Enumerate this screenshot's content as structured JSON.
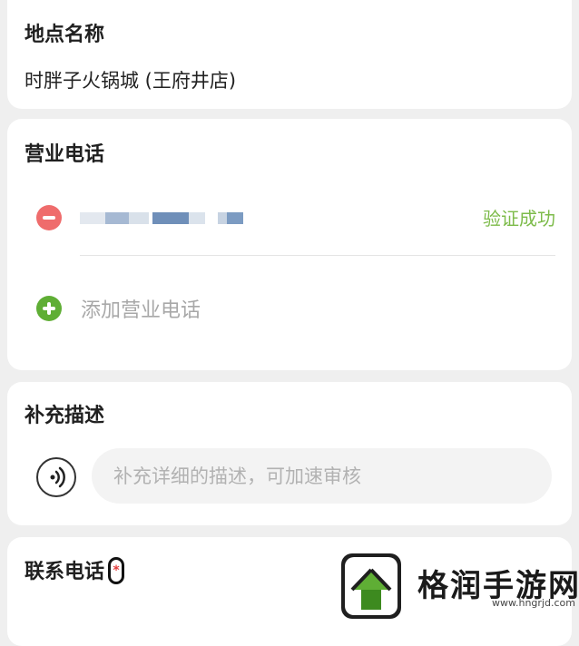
{
  "location": {
    "title": "地点名称",
    "value": "时胖子火锅城 (王府井店)"
  },
  "business_phone": {
    "title": "营业电话",
    "verify_status": "验证成功",
    "add_label": "添加营业电话",
    "colors": {
      "remove": "#ef6c6c",
      "add": "#5fae35",
      "verified": "#7dbb4a"
    }
  },
  "description": {
    "title": "补充描述",
    "placeholder": "补充详细的描述，可加速审核",
    "voice_icon": "voice-input-icon"
  },
  "contact_phone": {
    "title": "联系电话",
    "required_mark": "*"
  },
  "watermark": {
    "title": "格润手游网",
    "url": "www.hngrjd.com"
  }
}
